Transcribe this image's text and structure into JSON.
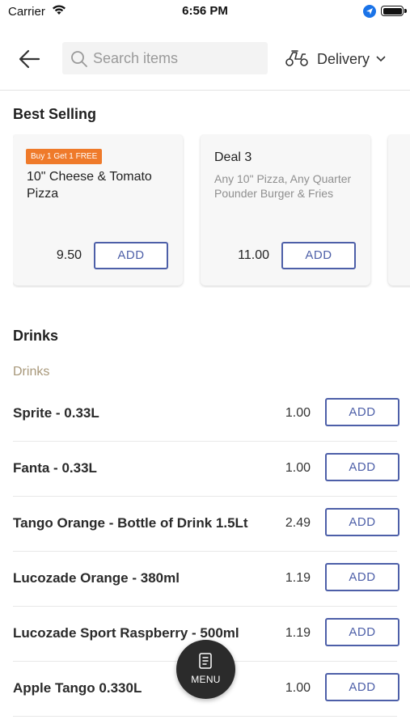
{
  "status_bar": {
    "carrier": "Carrier",
    "time": "6:56 PM"
  },
  "header": {
    "search_placeholder": "Search items",
    "delivery_label": "Delivery"
  },
  "best_selling": {
    "title": "Best Selling",
    "items": [
      {
        "badge": "Buy 1 Get 1 FREE",
        "name": "10\" Cheese & Tomato Pizza",
        "description": "",
        "price": "9.50",
        "add_label": "ADD"
      },
      {
        "badge": "",
        "name": "Deal 3",
        "description": "Any 10\" Pizza, Any Quarter Pounder Burger & Fries",
        "price": "11.00",
        "add_label": "ADD"
      }
    ]
  },
  "drinks": {
    "title": "Drinks",
    "subcategory": "Drinks",
    "items": [
      {
        "name": "Sprite - 0.33L",
        "price": "1.00",
        "add_label": "ADD"
      },
      {
        "name": "Fanta - 0.33L",
        "price": "1.00",
        "add_label": "ADD"
      },
      {
        "name": "Tango Orange - Bottle of Drink 1.5Lt",
        "price": "2.49",
        "add_label": "ADD"
      },
      {
        "name": "Lucozade Orange - 380ml",
        "price": "1.19",
        "add_label": "ADD"
      },
      {
        "name": "Lucozade Sport Raspberry - 500ml",
        "price": "1.19",
        "add_label": "ADD"
      },
      {
        "name": "Apple Tango 0.330L",
        "price": "1.00",
        "add_label": "ADD"
      }
    ]
  },
  "menu_button": {
    "label": "MENU"
  },
  "colors": {
    "accent": "#4d5fa8",
    "badge": "#ef7a2a",
    "subcategory": "#a8987a",
    "fab": "#2b2b2b"
  }
}
